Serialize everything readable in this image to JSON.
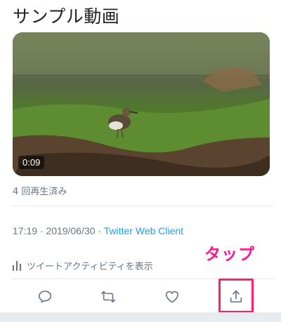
{
  "tweet": {
    "title": "サンプル動画",
    "video": {
      "duration": "0:09"
    },
    "views": "4 回再生済み",
    "timestamp": "17:19 · 2019/06/30 · ",
    "client": "Twitter Web Client",
    "activity_link": "ツイートアクティビティを表示"
  },
  "annotation": {
    "label": "タップ",
    "color": "#ff1f6b"
  },
  "actions": {
    "reply_icon": "reply-icon",
    "retweet_icon": "retweet-icon",
    "like_icon": "heart-icon",
    "share_icon": "share-icon"
  },
  "colors": {
    "link": "#1da1f2",
    "secondary_text": "#657786"
  }
}
